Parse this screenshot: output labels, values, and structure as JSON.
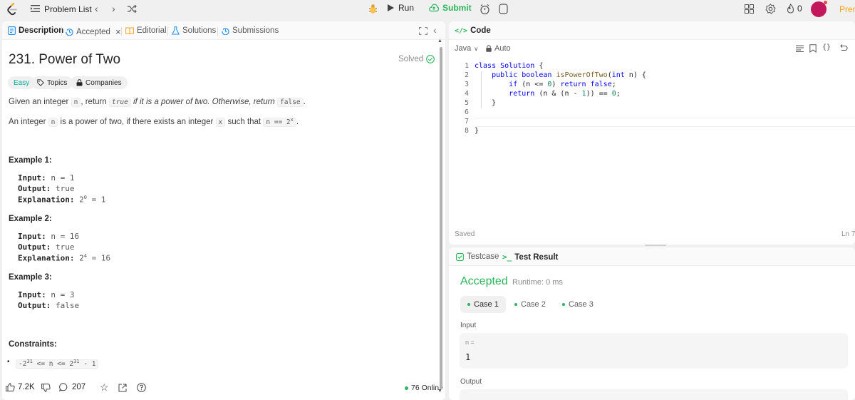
{
  "topbar": {
    "problem_list_label": "Problem List",
    "run_label": "Run",
    "submit_label": "Submit",
    "streak_count": "0",
    "premium_label": "Prem"
  },
  "left_tabs": [
    {
      "label": "Description"
    },
    {
      "label": "Accepted"
    },
    {
      "label": "Editorial"
    },
    {
      "label": "Solutions"
    },
    {
      "label": "Submissions"
    }
  ],
  "problem": {
    "title": "231. Power of Two",
    "solved_label": "Solved",
    "difficulty": "Easy",
    "topics_label": "Topics",
    "companies_label": "Companies",
    "desc1": {
      "a": "Given an integer ",
      "n": "n",
      "b": ", return ",
      "true": "true",
      "c": " if it is a power of two. Otherwise, return ",
      "false": "false",
      "d": "."
    },
    "desc2": {
      "a": "An integer ",
      "n": "n",
      "b": " is a power of two, if there exists an integer ",
      "x": "x",
      "c": " such that ",
      "expr": "n == 2",
      "exp": "x",
      "d": "."
    },
    "examples": [
      {
        "title": "Example 1:",
        "input_label": "Input:",
        "input": "n = 1",
        "output_label": "Output:",
        "output": "true",
        "explanation_label": "Explanation:",
        "explanation_base": "2",
        "explanation_exp": "0",
        "explanation_rest": "= 1"
      },
      {
        "title": "Example 2:",
        "input_label": "Input:",
        "input": "n = 16",
        "output_label": "Output:",
        "output": "true",
        "explanation_label": "Explanation:",
        "explanation_base": "2",
        "explanation_exp": "4",
        "explanation_rest": "= 16"
      },
      {
        "title": "Example 3:",
        "input_label": "Input:",
        "input": "n = 3",
        "output_label": "Output:",
        "output": "false"
      }
    ],
    "constraints_title": "Constraints:",
    "constraint": {
      "a": "-2",
      "a_exp": "31",
      "b": " <= n <= 2",
      "b_exp": "31",
      "c": " - 1"
    },
    "likes": "7.2K",
    "comments": "207",
    "online": "76 Online"
  },
  "code": {
    "header_label": "Code",
    "language": "Java",
    "mode": "Auto",
    "saved_label": "Saved",
    "cursor_label": "Ln 7,",
    "lines": [
      "1",
      "2",
      "3",
      "4",
      "5",
      "6",
      "7",
      "8"
    ]
  },
  "result": {
    "testcase_tab": "Testcase",
    "testresult_tab": "Test Result",
    "status": "Accepted",
    "runtime": "Runtime: 0 ms",
    "cases": [
      "Case 1",
      "Case 2",
      "Case 3"
    ],
    "input_label": "Input",
    "var_label": "n =",
    "var_value": "1",
    "output_label": "Output"
  },
  "colors": {
    "accent_green": "#2db55d",
    "easy": "#00af9b",
    "premium": "#ffa116"
  }
}
